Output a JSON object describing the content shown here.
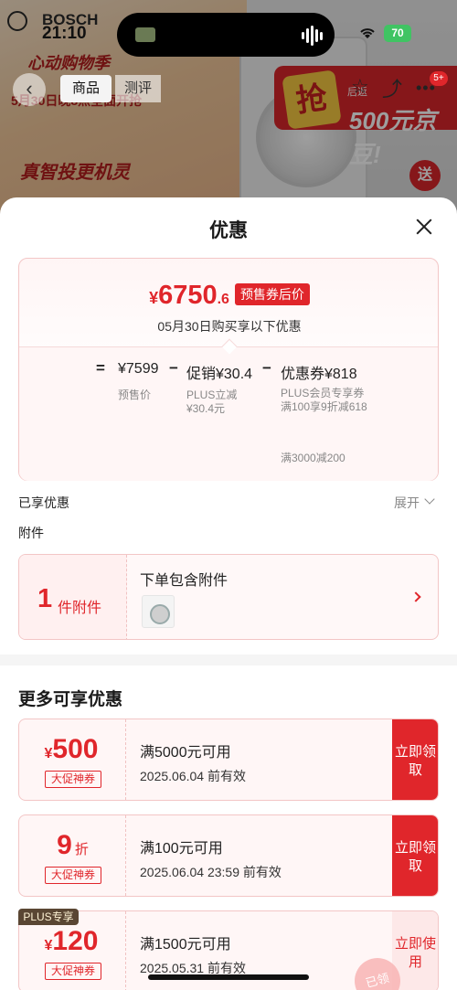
{
  "status_bar": {
    "time": "21:10",
    "battery": "70"
  },
  "background_page": {
    "brand": "BOSCH",
    "tabs": [
      "商品",
      "测评"
    ],
    "promo_line1": "心动购物季",
    "promo_line2": "5月30日晚8点全面开抢",
    "promo_line3": "真智投更机灵",
    "banner_badge": "抢",
    "banner_text": "500元京豆!",
    "banner_prefix": "后返",
    "send_badge": "送",
    "cart_badge": "5+"
  },
  "sheet": {
    "title": "优惠",
    "price": {
      "currency": "¥",
      "integer": "6750",
      "decimal": ".6",
      "tag": "预售券后价",
      "date_note": "05月30日购买享以下优惠"
    },
    "calc": {
      "eq": "=",
      "presale_price": "¥7599",
      "minus1": "−",
      "promo": "促销¥30.4",
      "minus2": "−",
      "coupon": "优惠券¥818",
      "presale_label": "预售价",
      "plus_label_1": "PLUS立减",
      "plus_label_2": "¥30.4元",
      "coupon_desc": "PLUS会员专享券 满100享9折减618",
      "coupon_desc2": "满3000减200"
    },
    "enjoyed": {
      "label": "已享优惠",
      "expand": "展开"
    },
    "accessory": {
      "section_label": "附件",
      "count": "1",
      "count_unit": "件附件",
      "title": "下单包含附件"
    },
    "more": {
      "title": "更多可享优惠",
      "coupons": [
        {
          "currency": "¥",
          "value": "500",
          "unit": "",
          "tag": "大促神券",
          "condition": "满5000元可用",
          "expire": "2025.06.04 前有效",
          "button": "立即领取"
        },
        {
          "currency": "",
          "value": "9",
          "unit": "折",
          "tag": "大促神券",
          "condition": "满100元可用",
          "expire": "2025.06.04 23:59 前有效",
          "button": "立即领取"
        },
        {
          "currency": "¥",
          "value": "120",
          "unit": "",
          "tag": "大促神券",
          "condition": "满1500元可用",
          "expire": "2025.05.31 前有效",
          "button": "立即使用",
          "flag": "PLUS专享"
        }
      ],
      "stamp": "已领"
    }
  }
}
